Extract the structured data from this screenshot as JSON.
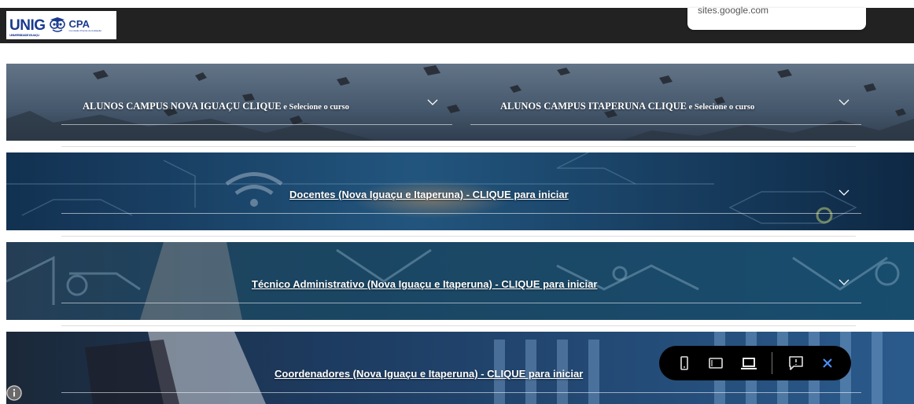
{
  "header": {
    "logo": {
      "brand": "UNIG",
      "brand_sub": "UNIVERSIDADE IGUAÇU",
      "cpa": "CPA",
      "cpa_sub": "Comissão Própria de Avaliação"
    },
    "url_popup": "sites.google.com"
  },
  "sections": {
    "alunos": {
      "left": {
        "main": "ALUNOS CAMPUS NOVA IGUAÇU CLIQUE",
        "small": " e Selecione o curso"
      },
      "right": {
        "main": "ALUNOS CAMPUS ITAPERUNA CLIQUE",
        "small": " e Selecione o curso"
      }
    },
    "docentes": "Docentes (Nova Iguaçu e Itaperuna) - CLIQUE para iniciar",
    "tecnico": "Técnico Administrativo (Nova Iguaçu e Itaperuna) - CLIQUE para iniciar",
    "coordenadores": "Coordenadores (Nova Iguaçu e Itaperuna) - CLIQUE para iniciar"
  },
  "toolbar": {
    "icons": [
      "phone-icon",
      "tablet-icon",
      "laptop-icon",
      "feedback-icon",
      "close-icon"
    ]
  },
  "colors": {
    "topbar": "#222222",
    "toolbar": "#000000",
    "close_icon": "#4d90fe",
    "band_alunos": "#3f5a72",
    "band_docentes": "#1d4f7a",
    "band_tecnico": "#1e5d82",
    "band_coordenadores": "#1b3f66"
  }
}
